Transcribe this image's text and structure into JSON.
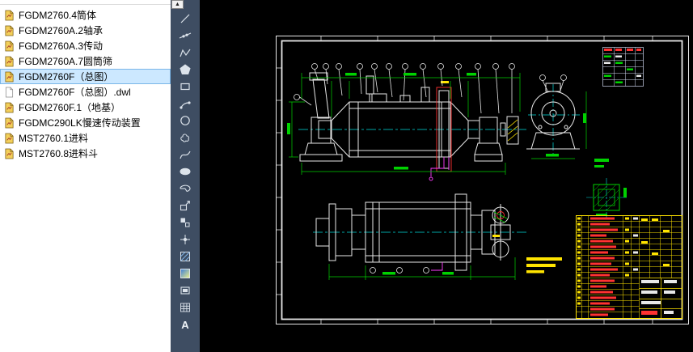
{
  "window": {
    "background": "#000000"
  },
  "file_panel": {
    "background": "#ffffff",
    "items": [
      {
        "label": "FGDM2760.4筒体",
        "icon": "dwg-file-icon",
        "selected": false
      },
      {
        "label": "FGDM2760A.2轴承",
        "icon": "dwg-file-icon",
        "selected": false
      },
      {
        "label": "FGDM2760A.3传动",
        "icon": "dwg-file-icon",
        "selected": false
      },
      {
        "label": "FGDM2760A.7圆筒筛",
        "icon": "dwg-file-icon",
        "selected": false
      },
      {
        "label": "FGDM2760F（总图）",
        "icon": "dwg-file-icon",
        "selected": true
      },
      {
        "label": "FGDM2760F（总图）.dwl",
        "icon": "dwl-file-icon",
        "selected": false
      },
      {
        "label": "FGDM2760F.1（地基）",
        "icon": "dwg-file-icon",
        "selected": false
      },
      {
        "label": "FGDMC290LK慢速传动装置",
        "icon": "dwg-file-icon",
        "selected": false
      },
      {
        "label": "MST2760.1进料",
        "icon": "dwg-file-icon",
        "selected": false
      },
      {
        "label": "MST2760.8进料斗",
        "icon": "dwg-file-icon",
        "selected": false
      }
    ]
  },
  "toolbar": {
    "background": "#3e4d62",
    "scroll_up_glyph": "▲",
    "mtext_glyph": "A",
    "tools": [
      "Line",
      "Construction Line",
      "Polyline",
      "Polygon",
      "Rectangle",
      "Arc",
      "Circle",
      "Revision Cloud",
      "Spline",
      "Ellipse",
      "Ellipse Arc",
      "Insert Block",
      "Make Block",
      "Point",
      "Hatch",
      "Gradient",
      "Region",
      "Table",
      "Multiline Text"
    ]
  },
  "canvas": {
    "background": "#000000",
    "palette": {
      "outline": "#e8e8e8",
      "centerline": "#00dcdc",
      "dimension": "#00d200",
      "highlight_red": "#ff3232",
      "annotation_yellow": "#ffe400",
      "piping_magenta": "#ff3cff"
    }
  }
}
